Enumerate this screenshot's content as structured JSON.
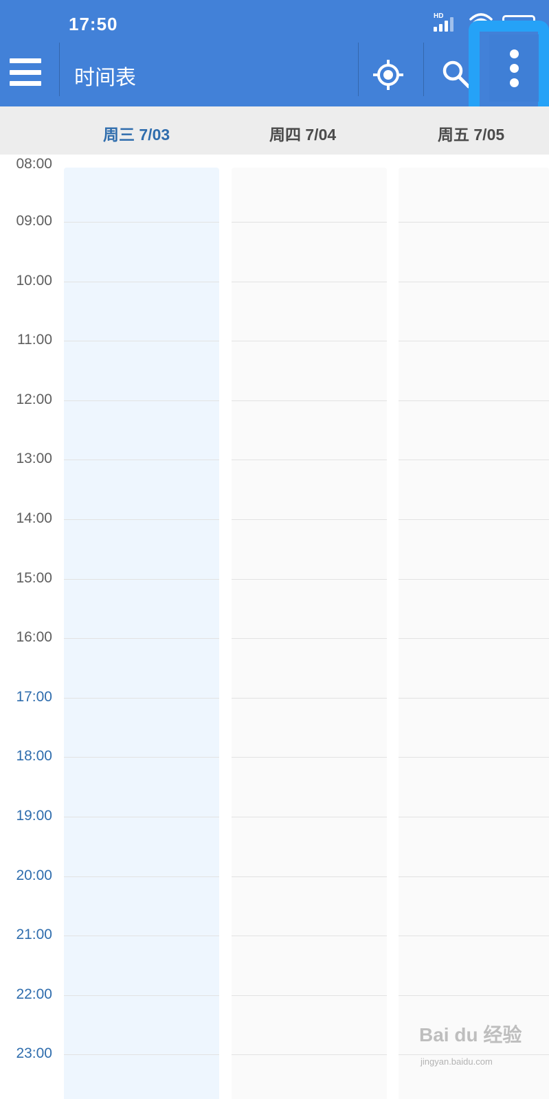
{
  "status_bar": {
    "time": "17:50",
    "signal_badge": "HD",
    "icons": [
      "signal-icon",
      "wifi-icon",
      "battery-icon"
    ]
  },
  "app_bar": {
    "title": "时间表",
    "background_color": "#4281d8",
    "actions": [
      "locate-icon",
      "search-icon",
      "more-vert-icon"
    ],
    "highlighted_action": "more-vert-icon",
    "highlight_color": "#25a2f7"
  },
  "day_header": {
    "days": [
      {
        "label": "周三 7/03",
        "is_today": true
      },
      {
        "label": "周四 7/04",
        "is_today": false
      },
      {
        "label": "周五 7/05",
        "is_today": false
      }
    ],
    "today_color": "#2f6dad"
  },
  "timeline": {
    "hours": [
      "08:00",
      "09:00",
      "10:00",
      "11:00",
      "12:00",
      "13:00",
      "14:00",
      "15:00",
      "16:00",
      "17:00",
      "18:00",
      "19:00",
      "20:00",
      "21:00",
      "22:00",
      "23:00"
    ],
    "highlight_from_index": 9,
    "highlight_color": "#2f6dad"
  },
  "watermark": {
    "logo": "Bai du 经验",
    "url": "jingyan.baidu.com"
  }
}
